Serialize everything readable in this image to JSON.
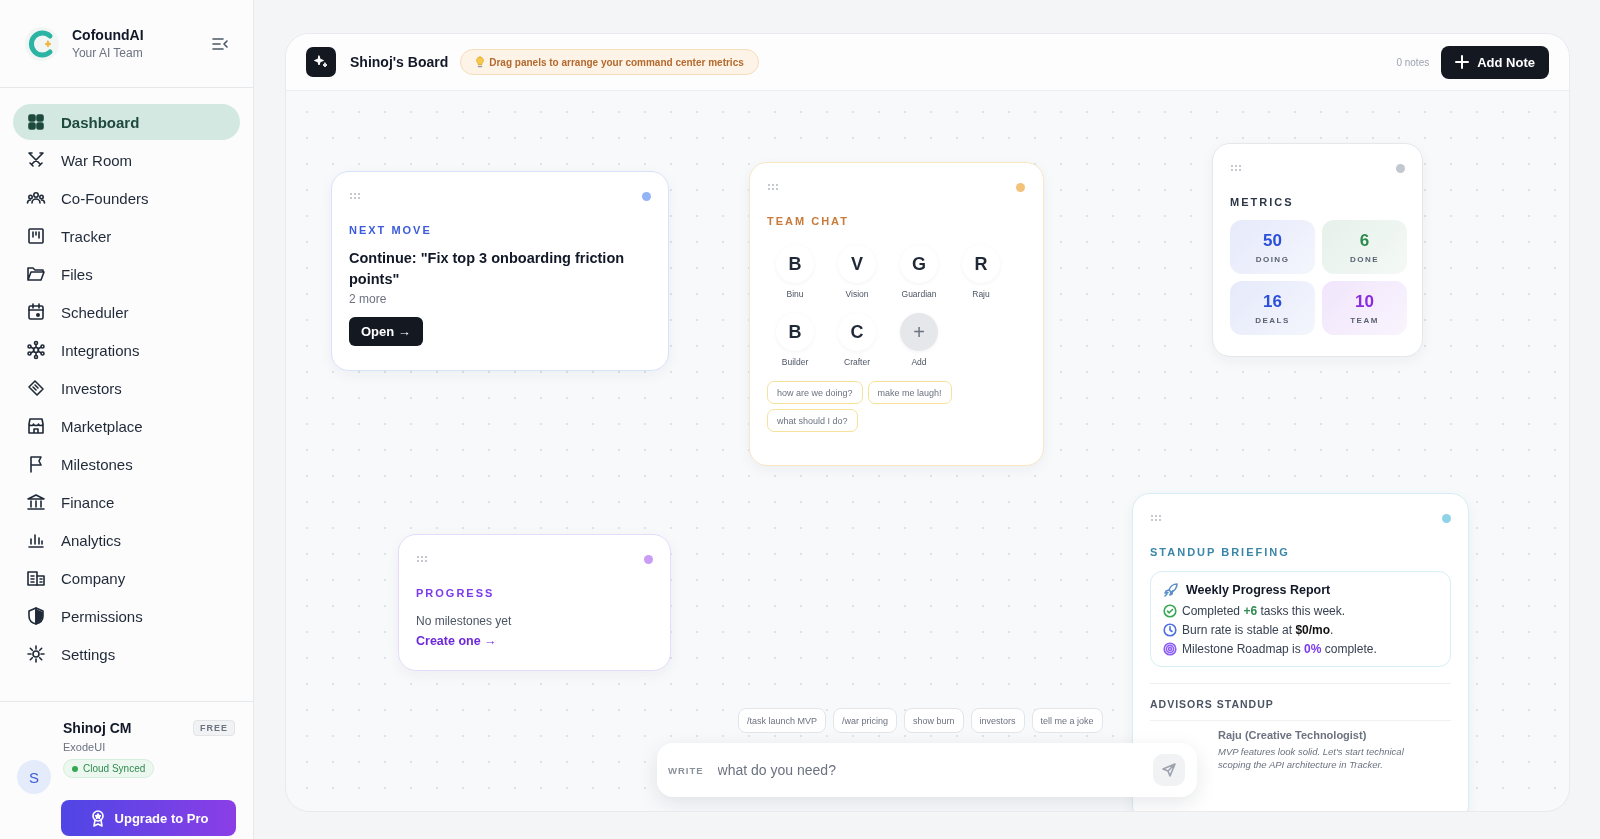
{
  "sidebar": {
    "brand": {
      "name": "CofoundAI",
      "tagline": "Your AI Team"
    },
    "items": [
      {
        "label": "Dashboard",
        "selected": true
      },
      {
        "label": "War Room",
        "selected": false
      },
      {
        "label": "Co-Founders",
        "selected": false
      },
      {
        "label": "Tracker",
        "selected": false
      },
      {
        "label": "Files",
        "selected": false
      },
      {
        "label": "Scheduler",
        "selected": false
      },
      {
        "label": "Integrations",
        "selected": false
      },
      {
        "label": "Investors",
        "selected": false
      },
      {
        "label": "Marketplace",
        "selected": false
      },
      {
        "label": "Milestones",
        "selected": false
      },
      {
        "label": "Finance",
        "selected": false
      },
      {
        "label": "Analytics",
        "selected": false
      },
      {
        "label": "Company",
        "selected": false
      },
      {
        "label": "Permissions",
        "selected": false
      },
      {
        "label": "Settings",
        "selected": false
      }
    ],
    "user": {
      "name": "Shinoj CM",
      "plan": "FREE",
      "org": "ExodeUI",
      "initial": "S",
      "sync": "Cloud Synced"
    },
    "upgrade": "Upgrade to Pro"
  },
  "board": {
    "title": "Shinoj's Board",
    "hint": "Drag panels to arrange your command center metrics",
    "notes": "0 notes",
    "add_note": "Add Note",
    "panels": [
      {
        "kind": "next_move",
        "color": "#93b4f5",
        "title": "NEXT MOVE",
        "task": "Continue: \"Fix top 3 onboarding friction points\"",
        "more": "2 more",
        "action": "Open →"
      },
      {
        "kind": "team_chat",
        "color": "#f3c27a",
        "title": "TEAM CHAT",
        "members": [
          {
            "kind": "member",
            "initial": "B",
            "name": "Binu"
          },
          {
            "kind": "member",
            "initial": "V",
            "name": "Vision"
          },
          {
            "kind": "member",
            "initial": "G",
            "name": "Guardian"
          },
          {
            "kind": "member",
            "initial": "R",
            "name": "Raju"
          },
          {
            "kind": "member",
            "initial": "B",
            "name": "Builder"
          },
          {
            "kind": "member",
            "initial": "C",
            "name": "Crafter"
          },
          {
            "kind": "add",
            "initial": "+",
            "name": "Add"
          }
        ],
        "prompts": [
          "how are we doing?",
          "make me laugh!",
          "what should I do?"
        ]
      },
      {
        "kind": "metrics",
        "color": "#c3c7cf",
        "title": "METRICS",
        "tiles": [
          {
            "value": "50",
            "label": "DOING",
            "color": "#2b4fd8"
          },
          {
            "value": "6",
            "label": "DONE",
            "color": "#2f8a4f"
          },
          {
            "value": "16",
            "label": "DEALS",
            "color": "#2b4fd8"
          },
          {
            "value": "10",
            "label": "TEAM",
            "color": "#8a2be2"
          }
        ]
      },
      {
        "kind": "progress",
        "color": "#c99cf5",
        "title": "PROGRESS",
        "empty": "No milestones yet",
        "action": "Create one →"
      },
      {
        "kind": "standup",
        "color": "#8fd3e6",
        "title": "STANDUP BRIEFING",
        "report_title": "Weekly Progress Report",
        "lines": [
          {
            "kind": "done",
            "text": "Completed **+6** tasks this week."
          },
          {
            "kind": "burn",
            "text": "Burn rate is stable at **$0/mo**."
          },
          {
            "kind": "milestone",
            "text": "Milestone Roadmap is **0%** complete."
          }
        ],
        "advisors_title": "ADVISORS STANDUP",
        "advisor": {
          "name": "Raju (Creative Technologist)",
          "quote": "MVP features look solid. Let's start technical scoping the API architecture in Tracker."
        }
      }
    ],
    "commands": [
      "/task launch MVP",
      "/war pricing",
      "show burn",
      "investors",
      "tell me a joke"
    ],
    "composer": {
      "label": "WRITE",
      "placeholder": "what do you need?"
    }
  }
}
